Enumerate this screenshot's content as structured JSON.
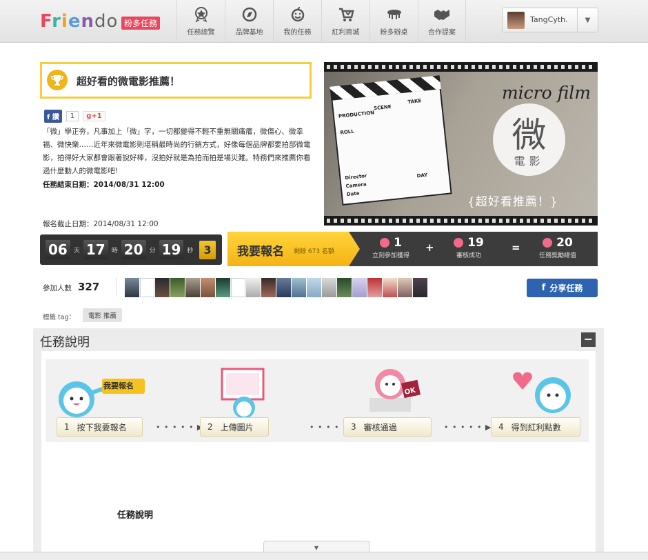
{
  "brand": {
    "logo": "Friendo",
    "badge": "粉多任務"
  },
  "nav": [
    {
      "label": "任務總覽",
      "icon": "badge-icon"
    },
    {
      "label": "品牌基地",
      "icon": "compass-icon"
    },
    {
      "label": "我的任務",
      "icon": "smiley-icon"
    },
    {
      "label": "紅利商城",
      "icon": "cart-icon"
    },
    {
      "label": "粉多辦桌",
      "icon": "table-icon"
    },
    {
      "label": "合作提案",
      "icon": "handshake-icon"
    }
  ],
  "user": {
    "name": "TangCyth.",
    "dropdown": "▼"
  },
  "task": {
    "title": "超好看的微電影推薦！",
    "fb_like_label": "讚",
    "like_count": "1",
    "gplus_label": "g+1",
    "description": "「微」學正夯，凡事加上「微」字，一切都變得不輕不重無關痛癢，微傷心、微幸福、微快樂……近年來微電影則堪稱最時尚的行銷方式，好像每個品牌都要拍部微電影，拍得好大家都會跟著說好棒，沒拍好就是為拍而拍是場災難。特務們來推薦你看過什麼動人的微電影吧!",
    "end_date": "任務結束日期：2014/08/31 12:00"
  },
  "hero": {
    "micro": "micro film",
    "big_char": "微",
    "subtitle": "電影",
    "tagline": "{超好看推薦！}",
    "clapper_labels": [
      "PRODUCTION",
      "SCENE",
      "TAKE",
      "ROLL",
      "Director",
      "Camera",
      "Date",
      "DAY"
    ]
  },
  "signup": {
    "deadline": "報名截止日期：2014/08/31 12:00",
    "countdown": {
      "days": "06",
      "days_unit": "天",
      "hours": "17",
      "hours_unit": "時",
      "minutes": "20",
      "minutes_unit": "分",
      "seconds": "19",
      "seconds_unit": "秒",
      "last_digit": "3"
    },
    "join_label": "我要報名",
    "remaining": "剩餘 673 名額",
    "stats": [
      {
        "value": "1",
        "label": "立刻參加獲得"
      },
      {
        "value": "19",
        "label": "審核成功"
      },
      {
        "value": "20",
        "label": "任務獎勵總值"
      }
    ],
    "plus": "+",
    "equals": "="
  },
  "participants": {
    "label": "參加人數",
    "count": "327",
    "share_label": "分享任務",
    "share_icon": "f"
  },
  "tags": {
    "label": "標籤 tag：",
    "items": [
      "電影 推薦"
    ]
  },
  "section": {
    "title": "任務說明",
    "collapse": "−",
    "steps": [
      {
        "num": "1",
        "label": "按下我要報名"
      },
      {
        "num": "2",
        "label": "上傳圖片"
      },
      {
        "num": "3",
        "label": "審核通過"
      },
      {
        "num": "4",
        "label": "得到紅利點數"
      }
    ],
    "step1_bubble": "我要報名",
    "arrow": "• • • • • ▶",
    "body_heading": "任務說明"
  },
  "footer": {
    "drawer_arrow": "▼"
  },
  "colors": {
    "accent_yellow": "#f4b314",
    "pink": "#f06b8a",
    "dark_bar": "#3c3c3c",
    "share_blue": "#2d63b0"
  }
}
